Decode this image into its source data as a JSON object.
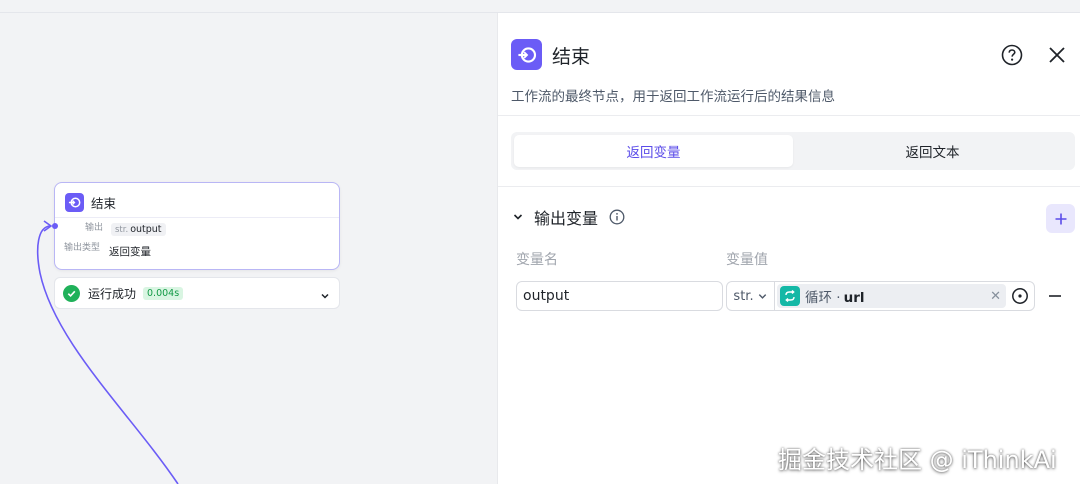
{
  "canvas": {
    "node": {
      "title": "结束",
      "output_key": "输出",
      "output_type": "str.",
      "output_value": "output",
      "mode_key": "输出类型",
      "mode_value": "返回变量"
    },
    "run_status": {
      "text": "运行成功",
      "time": "0.004s"
    }
  },
  "panel": {
    "title": "结束",
    "description": "工作流的最终节点，用于返回工作流运行后的结果信息",
    "tabs": [
      {
        "label": "返回变量",
        "active": true
      },
      {
        "label": "返回文本",
        "active": false
      }
    ],
    "section": {
      "title": "输出变量",
      "col_name": "变量名",
      "col_value": "变量值",
      "rows": [
        {
          "name": "output",
          "type": "str.",
          "ref_prefix": "循环 ·",
          "ref_var": "url"
        }
      ]
    }
  },
  "watermark": "掘金技术社区 @ iThinkAi",
  "colors": {
    "accent": "#6b5cf6",
    "success": "#20b15a",
    "loop": "#14b8a6"
  }
}
